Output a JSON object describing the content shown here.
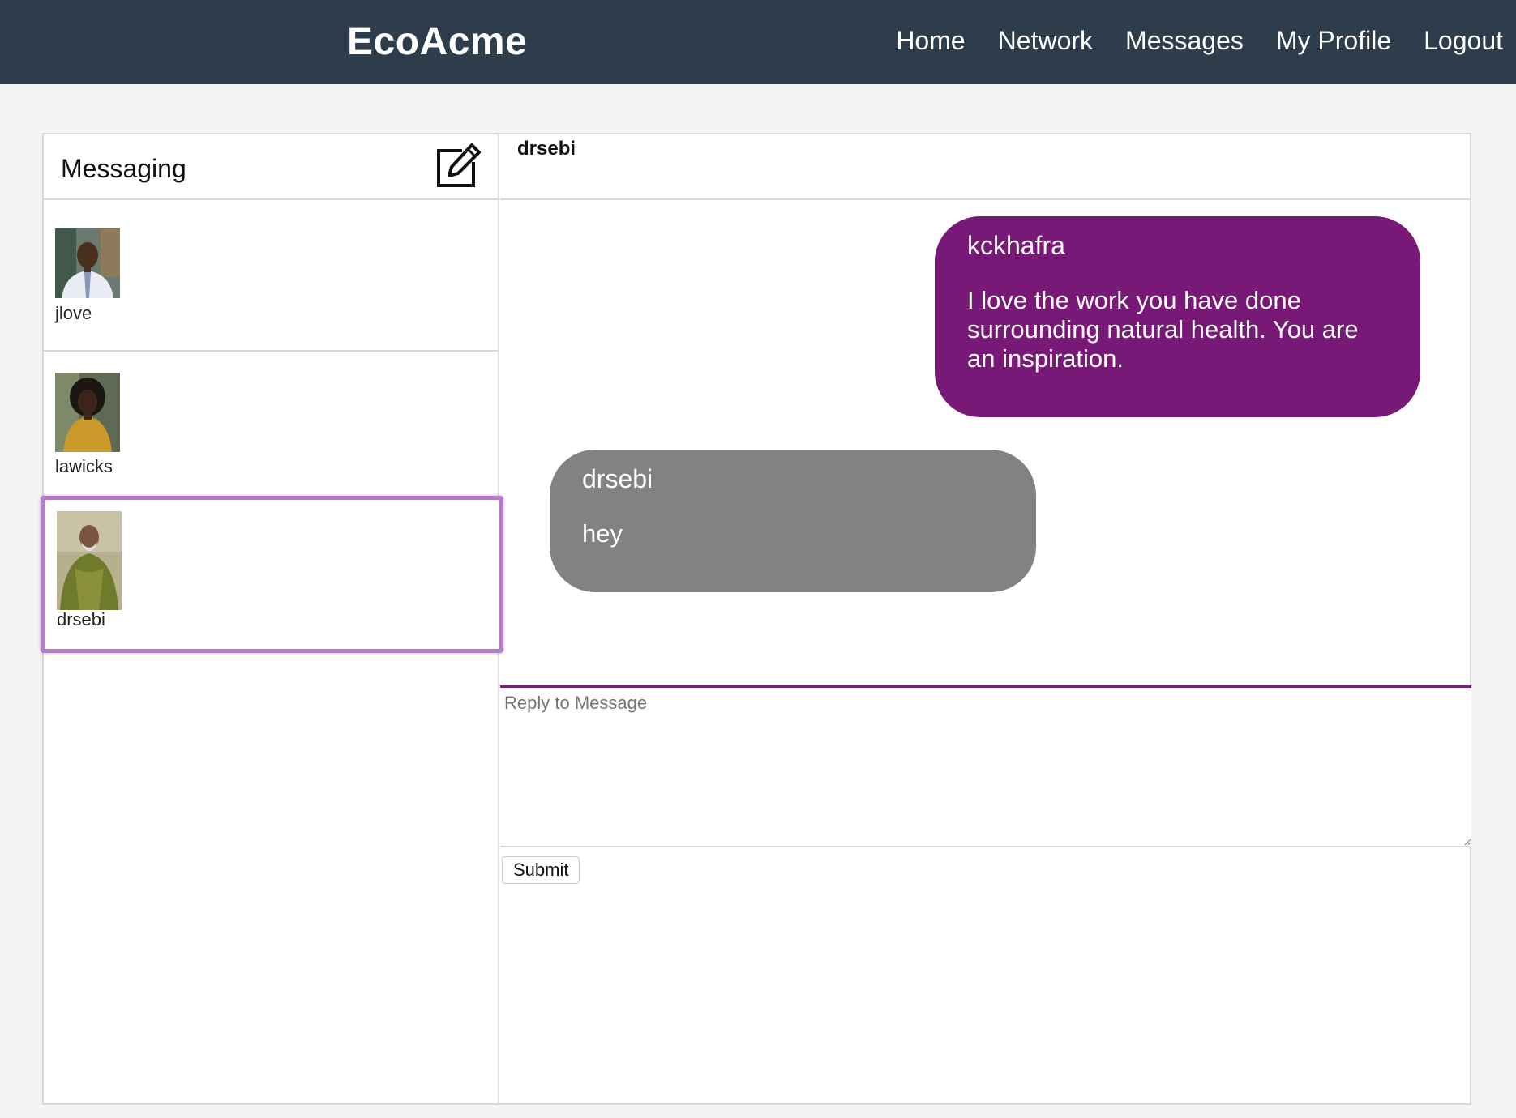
{
  "navbar": {
    "brand": "EcoAcme",
    "links": [
      "Home",
      "Network",
      "Messages",
      "My Profile",
      "Logout"
    ]
  },
  "sidebar": {
    "title": "Messaging",
    "compose_icon": "compose-edit-icon",
    "conversations": [
      {
        "name": "jlove",
        "selected": false
      },
      {
        "name": "lawicks",
        "selected": false
      },
      {
        "name": "drsebi",
        "selected": true
      }
    ]
  },
  "chat": {
    "title": "drsebi",
    "messages": [
      {
        "sender": "kckhafra",
        "text": "I love the work you have done surrounding natural health. You are an inspiration.",
        "direction": "sent"
      },
      {
        "sender": "drsebi",
        "text": "hey",
        "direction": "received"
      }
    ],
    "reply_placeholder": "Reply to Message",
    "reply_value": "",
    "submit_label": "Submit"
  },
  "colors": {
    "navbar": "#2d3d4b",
    "sent_bubble": "#781977",
    "received_bubble": "#828282",
    "selected_outline": "#b77bcb"
  }
}
